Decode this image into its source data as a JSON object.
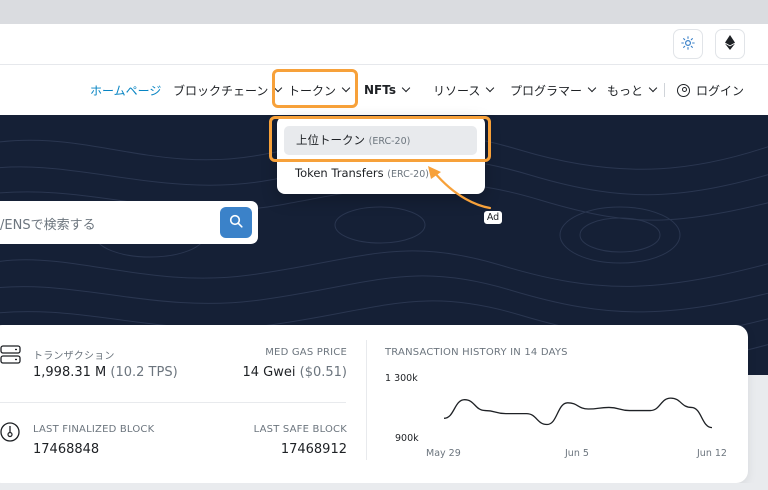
{
  "header": {
    "theme_icon": "sun-icon",
    "network_icon": "ethereum-icon"
  },
  "nav": {
    "home": "ホームページ",
    "blockchain": "ブロックチェーン",
    "tokens": "トークン",
    "nfts": "NFTs",
    "resources": "リソース",
    "developers": "プログラマー",
    "more": "もっと",
    "login": "ログイン"
  },
  "dropdown": {
    "items": [
      {
        "label": "上位トークン",
        "sub": "(ERC-20)"
      },
      {
        "label": "Token Transfers",
        "sub": "(ERC-20)"
      }
    ]
  },
  "search": {
    "placeholder": "/ENSで検索する"
  },
  "ad_badge": "Ad",
  "stats": {
    "transactions_label": "トランザクション",
    "transactions_value": "1,998.31 M",
    "transactions_tps": "(10.2 TPS)",
    "gas_label": "MED GAS PRICE",
    "gas_value": "14 Gwei",
    "gas_usd": "($0.51)",
    "finalized_label": "LAST FINALIZED BLOCK",
    "finalized_value": "17468848",
    "safe_label": "LAST SAFE BLOCK",
    "safe_value": "17468912"
  },
  "chart_data": {
    "type": "line",
    "title": "TRANSACTION HISTORY IN 14 DAYS",
    "xlabel": "",
    "ylabel": "",
    "y_ticks": [
      "1 300k",
      "900k"
    ],
    "ylim": [
      900000,
      1300000
    ],
    "x_ticks": [
      "May 29",
      "Jun 5",
      "Jun 12"
    ],
    "x": [
      "May 30",
      "May 31",
      "Jun 1",
      "Jun 2",
      "Jun 3",
      "Jun 4",
      "Jun 5",
      "Jun 6",
      "Jun 7",
      "Jun 8",
      "Jun 9",
      "Jun 10",
      "Jun 11",
      "Jun 12"
    ],
    "values": [
      1040000,
      1160000,
      1090000,
      1070000,
      1070000,
      1000000,
      1140000,
      1100000,
      1110000,
      1090000,
      1090000,
      1170000,
      1110000,
      980000
    ],
    "line_color": "#1e2125"
  }
}
